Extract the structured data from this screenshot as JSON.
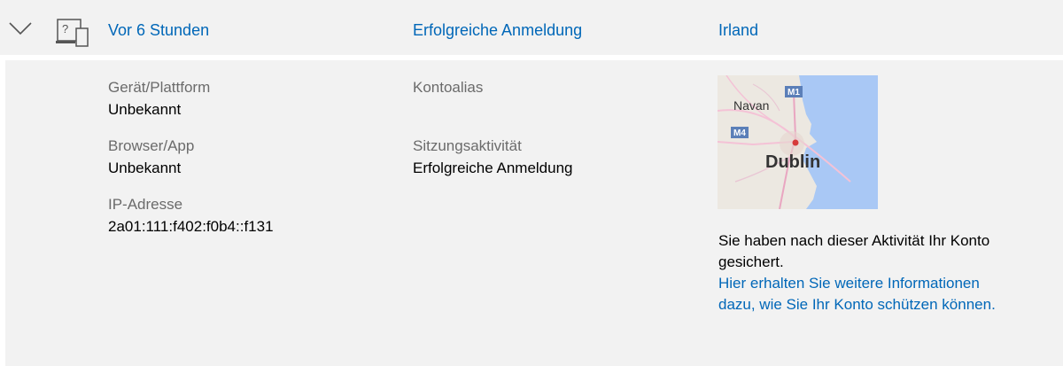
{
  "header": {
    "time": "Vor 6 Stunden",
    "status": "Erfolgreiche Anmeldung",
    "location": "Irland"
  },
  "details": {
    "device_label": "Gerät/Plattform",
    "device_value": "Unbekannt",
    "browser_label": "Browser/App",
    "browser_value": "Unbekannt",
    "ip_label": "IP-Adresse",
    "ip_value": "2a01:111:f402:f0b4::f131",
    "alias_label": "Kontoalias",
    "session_label": "Sitzungsaktivität",
    "session_value": "Erfolgreiche Anmeldung"
  },
  "map": {
    "city_main": "Dublin",
    "city_navan": "Navan",
    "road_m1": "M1",
    "road_m4": "M4",
    "sea_color": "#a9c8f5",
    "land_color": "#ece8e1"
  },
  "note": {
    "text": "Sie haben nach dieser Aktivität Ihr Konto gesichert.",
    "link": "Hier erhalten Sie weitere Informationen dazu, wie Sie Ihr Konto schützen können."
  },
  "colors": {
    "accent": "#0067b8",
    "panel": "#f2f2f2",
    "label": "#6b6b6b"
  }
}
